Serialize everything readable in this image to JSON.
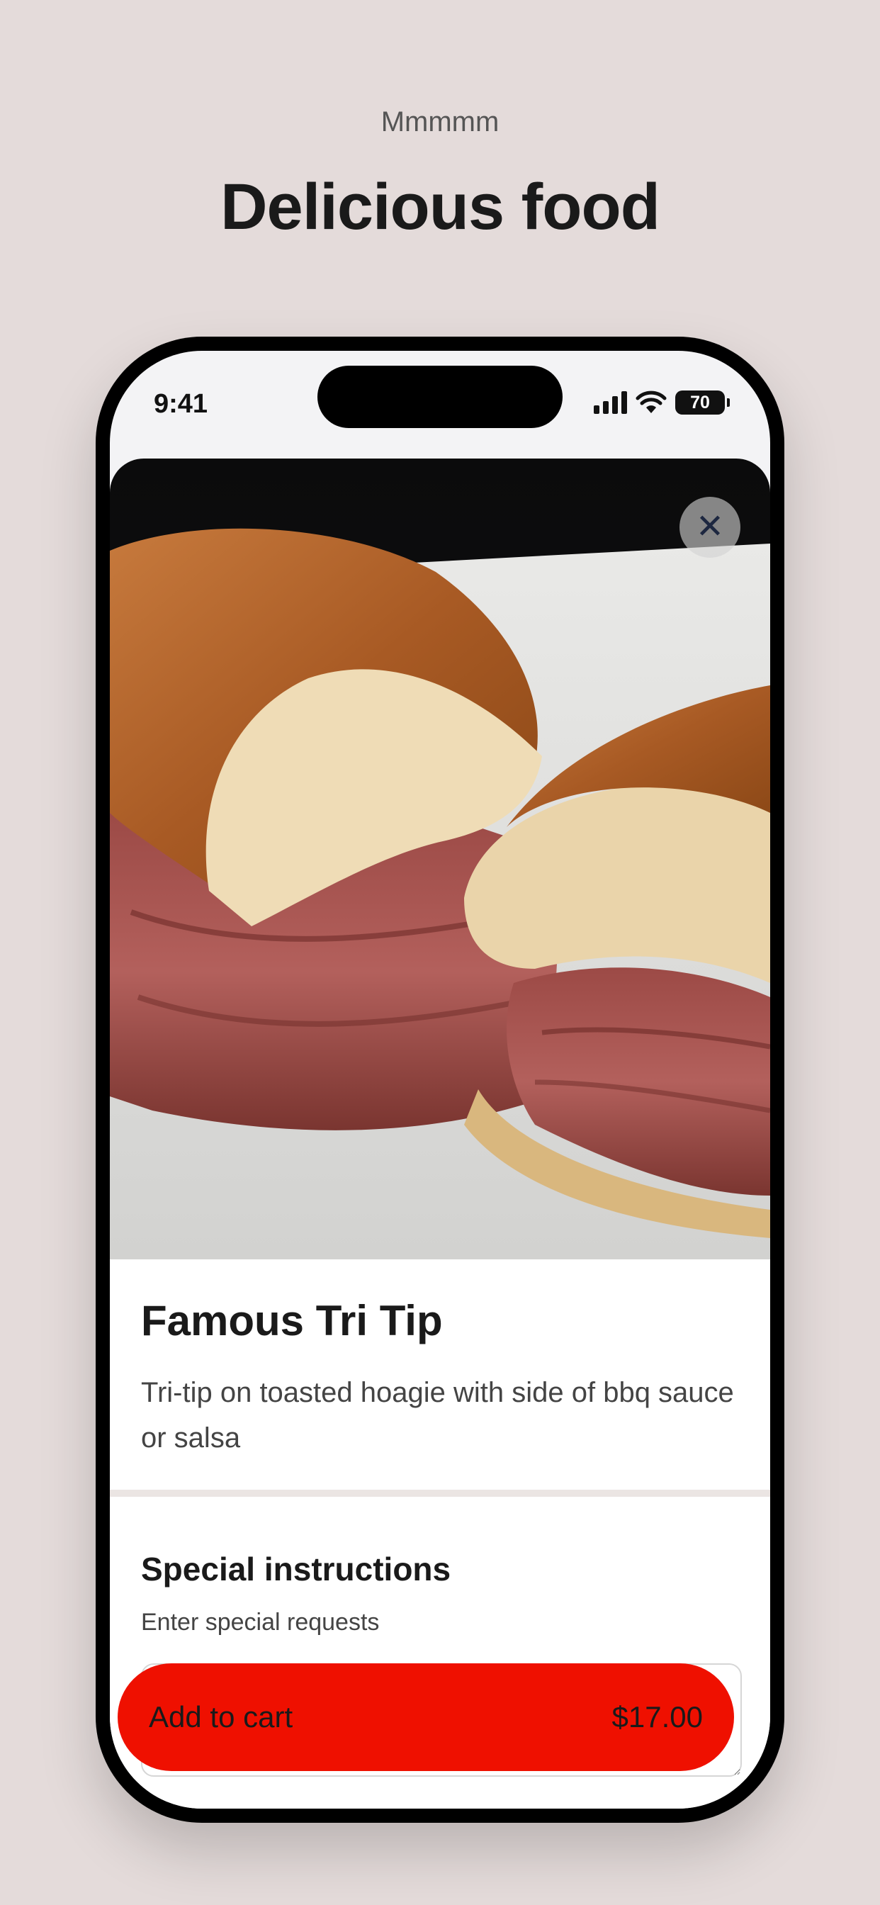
{
  "promo": {
    "kicker": "Mmmmm",
    "title": "Delicious food"
  },
  "status_bar": {
    "time": "9:41",
    "battery": "70"
  },
  "product": {
    "title": "Famous Tri Tip",
    "description": "Tri-tip on toasted hoagie with side of bbq sauce or salsa",
    "close_icon": "close-icon"
  },
  "special_instructions": {
    "title": "Special instructions",
    "subtitle": "Enter special requests",
    "input_value": ""
  },
  "cart_button": {
    "label": "Add to cart",
    "price": "$17.00"
  },
  "colors": {
    "background": "#e4dbda",
    "accent": "#ef1000"
  }
}
